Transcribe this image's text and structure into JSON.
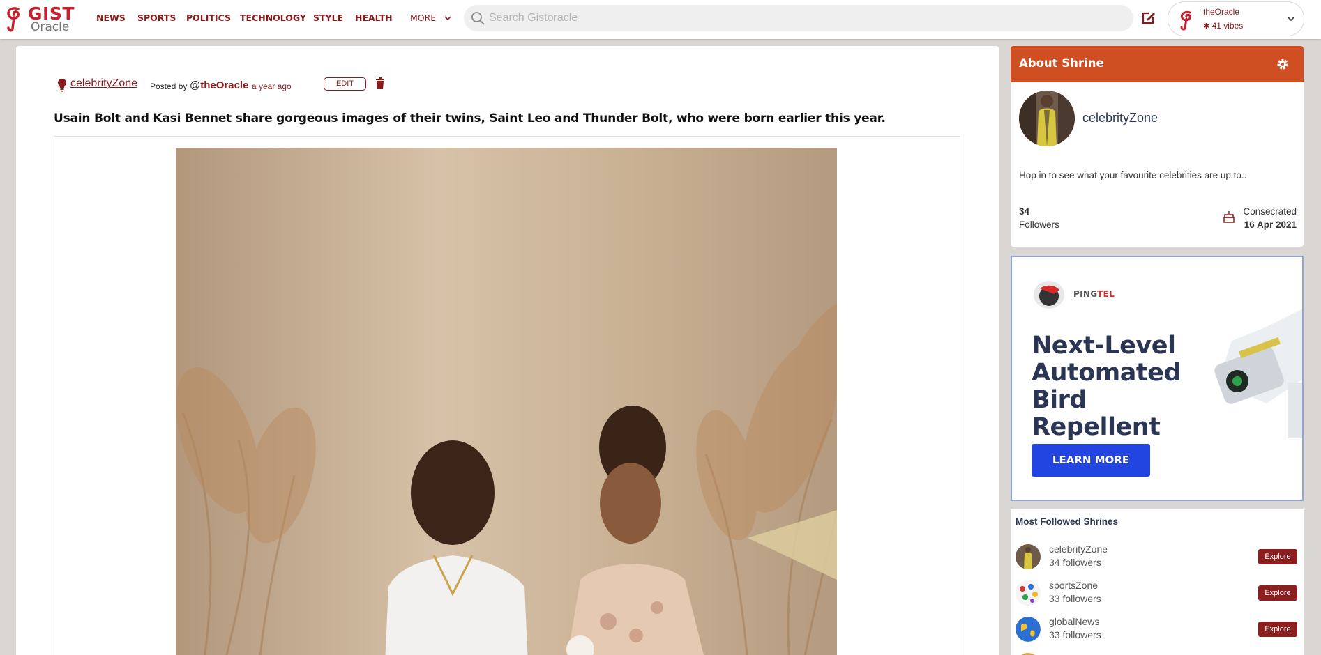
{
  "brand": {
    "name_line1": "GIST",
    "name_line2": "Oracle",
    "accent": "#c4212f"
  },
  "nav": {
    "links": [
      "NEWS",
      "SPORTS",
      "POLITICS",
      "TECHNOLOGY",
      "STYLE",
      "HEALTH"
    ],
    "more_label": "MORE"
  },
  "search": {
    "placeholder": "Search Gistoracle",
    "value": ""
  },
  "user": {
    "name": "theOracle",
    "vibes": "41 vibes"
  },
  "post": {
    "shrine": "celebrityZone",
    "posted_by_label": "Posted by",
    "author_prefix": "@",
    "author": "theOracle",
    "time": "a year ago",
    "edit_label": "EDIT",
    "title": "Usain Bolt and Kasi Bennet share gorgeous images of their twins, Saint Leo and Thunder Bolt, who were born earlier this year."
  },
  "about": {
    "title": "About Shrine",
    "name": "celebrityZone",
    "description": "Hop in to see what your favourite celebrities are up to..",
    "followers_count": "34",
    "followers_label": "Followers",
    "consecrated_label": "Consecrated",
    "consecrated_date": "16 Apr 2021",
    "header_color": "#cf4f22"
  },
  "ad": {
    "brand_a": "PING",
    "brand_b": "TEL",
    "headline": "Next-Level Automated Bird Repellent Laser !",
    "cta": "LEARN MORE"
  },
  "most_followed": {
    "title": "Most Followed Shrines",
    "items": [
      {
        "name": "celebrityZone",
        "followers": "34 followers",
        "action": "Explore"
      },
      {
        "name": "sportsZone",
        "followers": "33 followers",
        "action": "Explore"
      },
      {
        "name": "globalNews",
        "followers": "33 followers",
        "action": "Explore"
      }
    ]
  }
}
